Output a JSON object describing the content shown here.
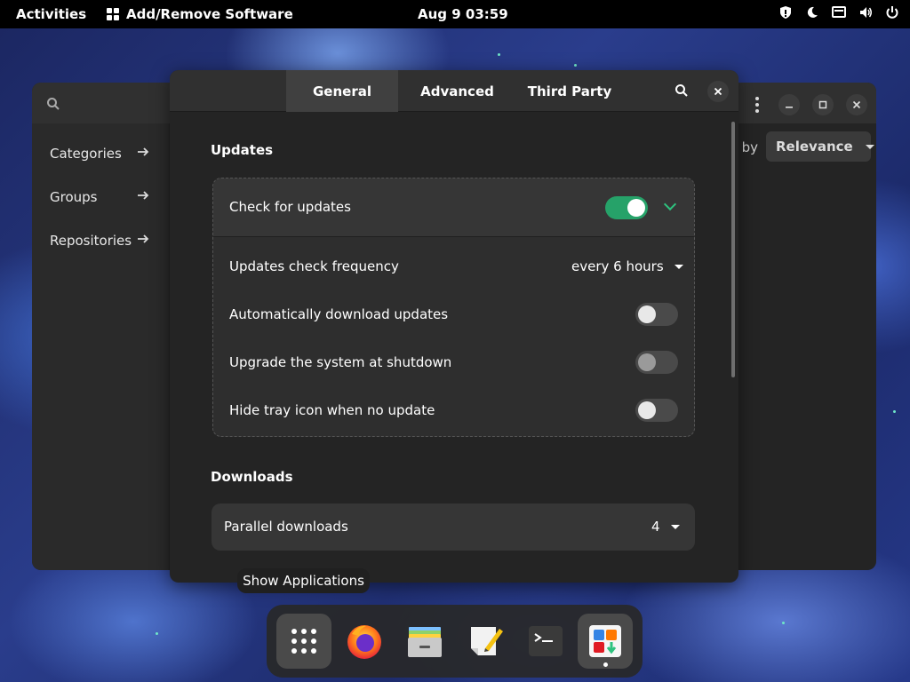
{
  "topbar": {
    "activities": "Activities",
    "app_name": "Add/Remove Software",
    "clock": "Aug 9  03:59",
    "tray_icons": [
      "shield-icon",
      "night-light-icon",
      "screen-icon",
      "volume-icon",
      "power-icon"
    ]
  },
  "background_window": {
    "sidebar": {
      "items": [
        {
          "label": "Categories"
        },
        {
          "label": "Groups"
        },
        {
          "label": "Repositories"
        }
      ]
    },
    "sort_label": "t by",
    "sort_value": "Relevance"
  },
  "dialog": {
    "tabs": [
      {
        "label": "General",
        "active": true
      },
      {
        "label": "Advanced",
        "active": false
      },
      {
        "label": "Third Party",
        "active": false
      }
    ],
    "updates": {
      "title": "Updates",
      "check_for_updates": {
        "label": "Check for updates",
        "enabled": true
      },
      "frequency": {
        "label": "Updates check frequency",
        "value": "every 6 hours"
      },
      "auto_download": {
        "label": "Automatically download updates",
        "enabled": false
      },
      "upgrade_shutdown": {
        "label": "Upgrade the system at shutdown",
        "enabled": false
      },
      "hide_tray": {
        "label": "Hide tray icon when no update",
        "enabled": false
      }
    },
    "downloads": {
      "title": "Downloads",
      "parallel": {
        "label": "Parallel downloads",
        "value": "4"
      }
    }
  },
  "tooltip": "Show Applications",
  "dock": {
    "items": [
      "show-applications",
      "firefox",
      "files",
      "text-editor",
      "terminal",
      "add-remove-software"
    ]
  },
  "colors": {
    "accent": "#26a269",
    "panel": "#242424",
    "topbar": "#000000"
  }
}
